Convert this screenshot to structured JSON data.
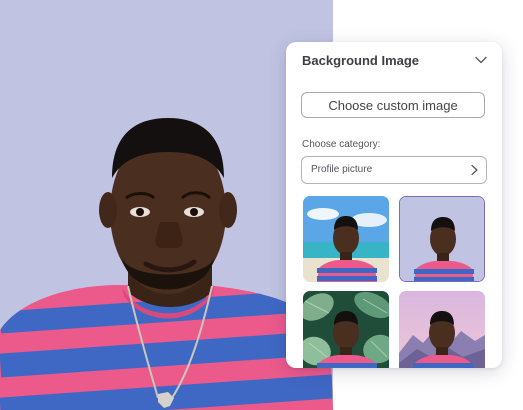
{
  "panel": {
    "title": "Background Image",
    "custom_button_label": "Choose custom image",
    "category_label": "Choose category:",
    "category_value": "Profile picture"
  },
  "thumbnails": [
    {
      "name": "beach",
      "selected": false
    },
    {
      "name": "lavender-solid",
      "selected": true
    },
    {
      "name": "tropical-leaves",
      "selected": false
    },
    {
      "name": "pink-mountains",
      "selected": false
    }
  ],
  "icons": {
    "collapse": "chevron-down-icon",
    "category_arrow": "chevron-right-icon"
  },
  "colors": {
    "photo_background": "#c0c4e2",
    "selected_border": "#7c6cc0",
    "shirt_pink": "#ec5a8c",
    "shirt_blue": "#3f68c4"
  }
}
